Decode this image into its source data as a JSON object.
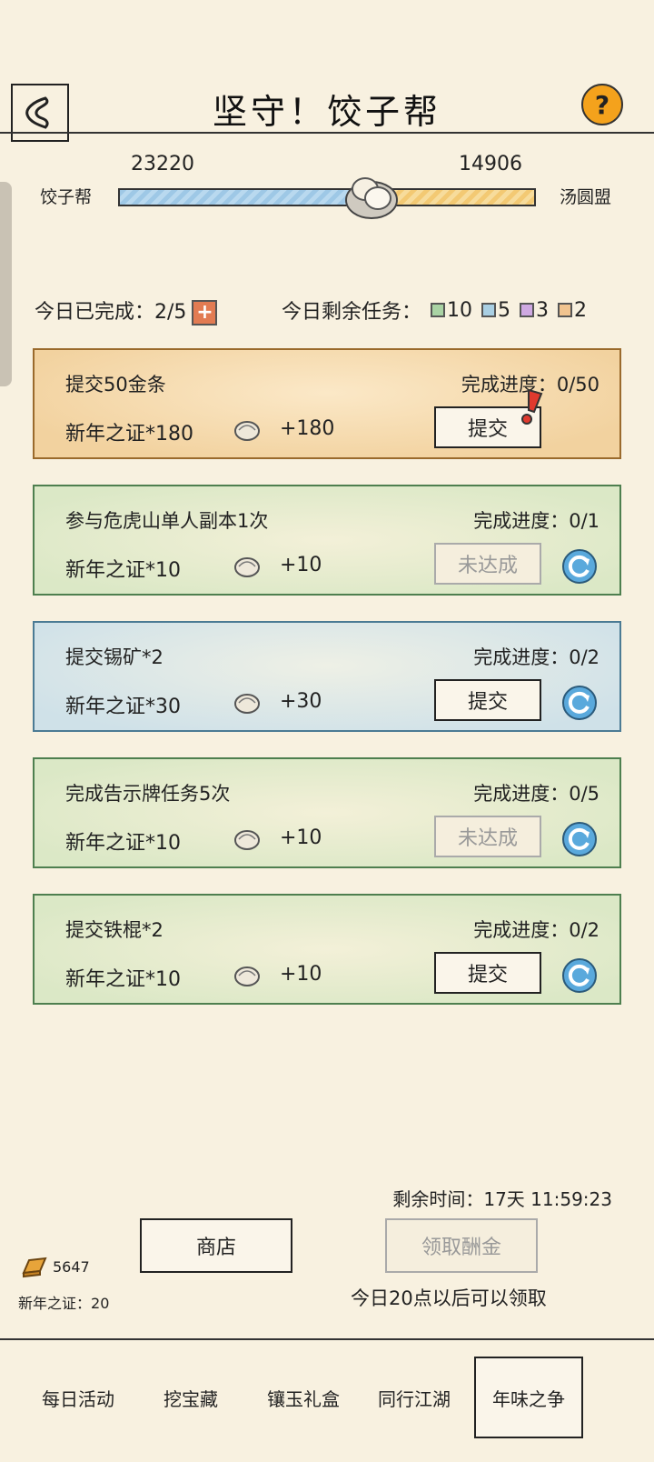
{
  "header": {
    "title": "坚守！饺子帮",
    "help_label": "?"
  },
  "versus": {
    "left_team": "饺子帮",
    "left_score": "23220",
    "right_team": "汤圆盟",
    "right_score": "14906",
    "left_share": 0.609,
    "left_color": "#9ec8e6",
    "right_color": "#f3c973"
  },
  "daily": {
    "completed_label": "今日已完成：",
    "completed_value": "2/5",
    "plus_icon": "plus-icon",
    "remaining_label": "今日剩余任务：",
    "remaining": [
      {
        "color": "#a9d3a4",
        "count": "10"
      },
      {
        "color": "#a9cfe3",
        "count": "5"
      },
      {
        "color": "#cfa9e2",
        "count": "3"
      },
      {
        "color": "#f1c490",
        "count": "2"
      }
    ]
  },
  "tasks": [
    {
      "name": "提交50金条",
      "reward": "新年之证*180",
      "bonus": "+180",
      "progress_label": "完成进度：",
      "progress": "0/50",
      "action": "提交",
      "theme": "orange"
    },
    {
      "name": "参与危虎山单人副本1次",
      "reward": "新年之证*10",
      "bonus": "+10",
      "progress_label": "完成进度：",
      "progress": "0/1",
      "action": "未达成",
      "theme": "green"
    },
    {
      "name": "提交锡矿*2",
      "reward": "新年之证*30",
      "bonus": "+30",
      "progress_label": "完成进度：",
      "progress": "0/2",
      "action": "提交",
      "theme": "blue"
    },
    {
      "name": "完成告示牌任务5次",
      "reward": "新年之证*10",
      "bonus": "+10",
      "progress_label": "完成进度：",
      "progress": "0/5",
      "action": "未达成",
      "theme": "green"
    },
    {
      "name": "提交铁棍*2",
      "reward": "新年之证*10",
      "bonus": "+10",
      "progress_label": "完成进度：",
      "progress": "0/2",
      "action": "提交",
      "theme": "green"
    }
  ],
  "footer": {
    "timer_label": "剩余时间：",
    "timer_value": "17天 11:59:23",
    "shop_label": "商店",
    "claim_label": "领取酬金",
    "claim_note": "今日20点以后可以领取",
    "gold_count": "5647",
    "token_label": "新年之证：",
    "token_count": "20"
  },
  "tabs": [
    {
      "label": "每日活动",
      "active": false
    },
    {
      "label": "挖宝藏",
      "active": false
    },
    {
      "label": "镶玉礼盒",
      "active": false
    },
    {
      "label": "同行江湖",
      "active": false
    },
    {
      "label": "年味之争",
      "active": true
    }
  ]
}
